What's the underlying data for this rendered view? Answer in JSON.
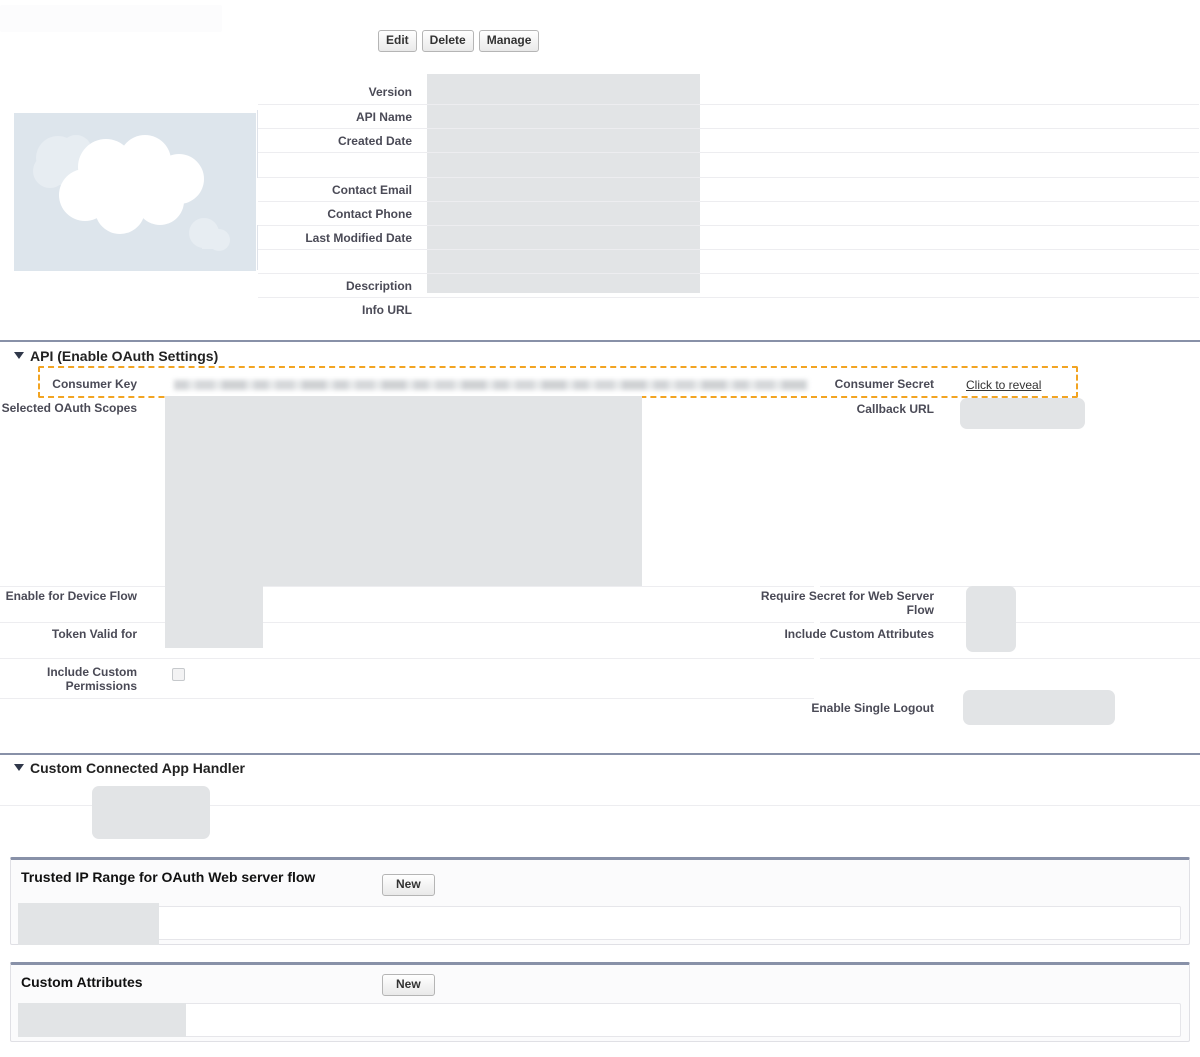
{
  "page": {
    "title_redacted": true
  },
  "toolbar": {
    "edit_label": "Edit",
    "delete_label": "Delete",
    "manage_label": "Manage"
  },
  "detail": {
    "fields_left": [
      {
        "label": "Version"
      },
      {
        "label": "API Name"
      },
      {
        "label": "Created Date"
      },
      {
        "label": ""
      },
      {
        "label": "Contact Email"
      },
      {
        "label": "Contact Phone"
      },
      {
        "label": "Last Modified Date"
      },
      {
        "label": ""
      },
      {
        "label": "Description"
      },
      {
        "label": "Info URL"
      }
    ]
  },
  "api_section": {
    "title": "API (Enable OAuth Settings)",
    "consumer_key_label": "Consumer Key",
    "consumer_secret_label": "Consumer Secret",
    "consumer_secret_link": "Click to reveal",
    "selected_oauth_scopes_label": "Selected OAuth Scopes",
    "callback_url_label": "Callback URL",
    "enable_device_flow_label": "Enable for Device Flow",
    "require_secret_web_server_label": "Require Secret for Web Server Flow",
    "token_valid_for_label": "Token Valid for",
    "include_custom_attributes_label": "Include Custom Attributes",
    "include_custom_permissions_label": "Include Custom Permissions",
    "enable_single_logout_label": "Enable Single Logout"
  },
  "handler_section": {
    "title": "Custom Connected App Handler"
  },
  "trusted_ip_list": {
    "title": "Trusted IP Range for OAuth Web server flow",
    "new_label": "New"
  },
  "custom_attributes_list": {
    "title": "Custom Attributes",
    "new_label": "New"
  },
  "colors": {
    "highlight": "#f2a422",
    "section_rule": "#8891a8",
    "placeholder": "#e2e4e6",
    "cloud_bg": "#dde5ec"
  }
}
